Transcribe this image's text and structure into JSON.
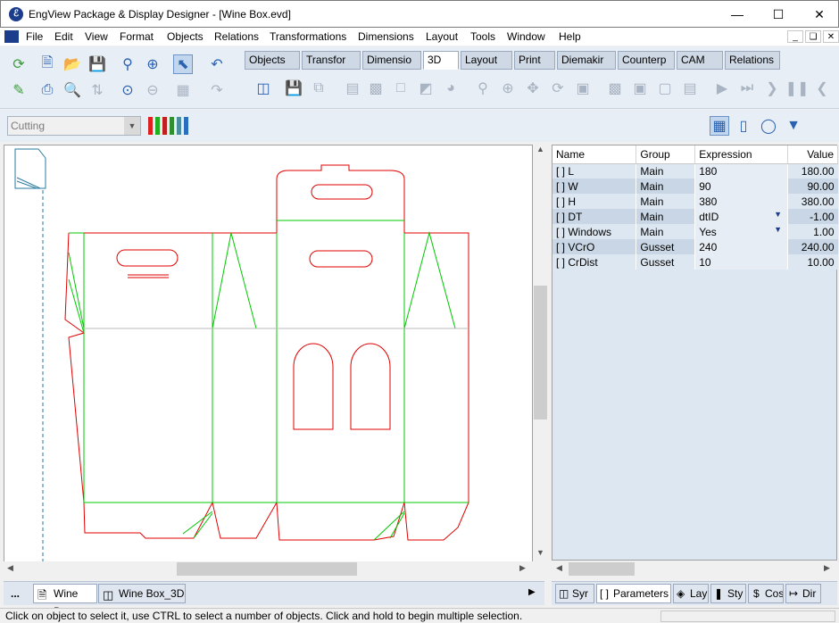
{
  "window": {
    "title": "EngView Package & Display Designer - [Wine Box.evd]",
    "app_icon": "engview-logo-icon"
  },
  "menu": [
    "File",
    "Edit",
    "View",
    "Format",
    "Objects",
    "Relations",
    "Transformations",
    "Dimensions",
    "Layout",
    "Tools",
    "Window",
    "Help"
  ],
  "toolbar_tabs": [
    "Objects",
    "Transfor",
    "Dimensio",
    "3D",
    "Layout",
    "Print",
    "Diemakir",
    "Counterp",
    "CAM",
    "Relations"
  ],
  "active_tab": "3D",
  "combo": {
    "value": "Cutting"
  },
  "properties": {
    "headers": [
      "Name",
      "Group",
      "Expression",
      "Value"
    ],
    "rows": [
      {
        "name": "[ ] L",
        "group": "Main",
        "expr": "180",
        "value": "180.00"
      },
      {
        "name": "[ ] W",
        "group": "Main",
        "expr": "90",
        "value": "90.00"
      },
      {
        "name": "[ ] H",
        "group": "Main",
        "expr": "380",
        "value": "380.00"
      },
      {
        "name": "[ ] DT",
        "group": "Main",
        "expr": "dtID",
        "value": "-1.00"
      },
      {
        "name": "[ ] Windows",
        "group": "Main",
        "expr": "Yes",
        "value": "1.00"
      },
      {
        "name": "[ ] VCrO",
        "group": "Gusset",
        "expr": "240",
        "value": "240.00"
      },
      {
        "name": "[ ] CrDist",
        "group": "Gusset",
        "expr": "10",
        "value": "10.00"
      }
    ]
  },
  "doc_tabs": {
    "more": "...",
    "tab1": "Wine Box",
    "tab2": "Wine Box_3D"
  },
  "prop_tabs": [
    "Syr",
    "Parameters",
    "Lay",
    "Sty",
    "Cos",
    "Dir"
  ],
  "status": "Click on object to select it, use CTRL to select a number of objects. Click and hold to begin multiple selection.",
  "colors": {
    "cut": "#e00000",
    "crease": "#00c800",
    "toolbar_bg": "#e8eef6",
    "grid_row": "#c8d6e6"
  }
}
